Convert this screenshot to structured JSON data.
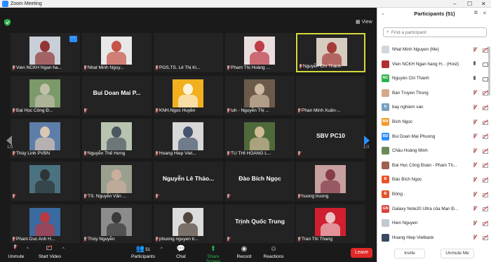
{
  "window": {
    "title": "Zoom Meeting",
    "minimize": "–",
    "maximize": "☐",
    "close": "✕"
  },
  "video": {
    "view_label": "View",
    "page_left": "1/3",
    "page_right": "1/3",
    "tiles": [
      {
        "label": "Vien NCKH Ngan ha...",
        "kind": "photo",
        "photo_color": "#c9cfd6",
        "accent": "#8a1a1a"
      },
      {
        "label": "Nhat Minh Nguy...",
        "kind": "photo",
        "photo_color": "#e8e8e8",
        "accent": "#c0392b"
      },
      {
        "label": "PGS,TS. Lê Thị Ki...",
        "kind": "empty"
      },
      {
        "label": "Pham Thị Hoàng ...",
        "kind": "photo",
        "photo_color": "#e9dede",
        "accent": "#b7202e"
      },
      {
        "label": "Nguyễn Chí Thành",
        "kind": "photo",
        "photo_color": "#d7ccc0",
        "accent": "#9b2222",
        "active": true
      },
      {
        "label": "Đại Học Công Đ...",
        "kind": "photo",
        "photo_color": "#7a9a6a",
        "accent": "#cfc5b5"
      },
      {
        "label": "",
        "kind": "name",
        "bigname": "Bui Doan Mai P..."
      },
      {
        "label": "KNH.Ngoc Huyền",
        "kind": "photo",
        "photo_color": "#f2b01e",
        "accent": "#ffffff"
      },
      {
        "label": "iuh - Nguyễn Thị ...",
        "kind": "photo",
        "photo_color": "#6b5a4a",
        "accent": "#e0c9b0"
      },
      {
        "label": "Phan Minh Xuân-...",
        "kind": "empty"
      },
      {
        "label": "Thùy Linh PVBN",
        "kind": "photo",
        "photo_color": "#5d7ea8",
        "accent": "#f1d3b7"
      },
      {
        "label": "Nguyễn Thế Hưng",
        "kind": "photo",
        "photo_color": "#b8c4b0",
        "accent": "#384552"
      },
      {
        "label": "Hoang Hiep Viet...",
        "kind": "photo",
        "photo_color": "#d8d8d8",
        "accent": "#2b3d5a"
      },
      {
        "label": "TU THI HOANG L...",
        "kind": "photo",
        "photo_color": "#4f6a3a",
        "accent": "#e8c8a8"
      },
      {
        "label": "",
        "kind": "name",
        "bigname": "SBV PC10"
      },
      {
        "label": "",
        "kind": "photo",
        "photo_color": "#4b7280",
        "accent": "#2a2a2a"
      },
      {
        "label": "TS. Nguyễn Văn ...",
        "kind": "photo",
        "photo_color": "#9aa090",
        "accent": "#d5b0a0"
      },
      {
        "label": "",
        "kind": "name",
        "bigname": "Nguyễn Lê Thảo..."
      },
      {
        "label": "",
        "kind": "name",
        "bigname": "Đào Bích Ngọc"
      },
      {
        "label": "huong truong",
        "kind": "photo",
        "photo_color": "#c8a0a0",
        "accent": "#7a2a3a"
      },
      {
        "label": "Pham Duc Anh H...",
        "kind": "photo",
        "photo_color": "#3a6aa0",
        "accent": "#d03030"
      },
      {
        "label": "Thúy Nguyễn",
        "kind": "photo",
        "photo_color": "#8c8c8c",
        "accent": "#2a2a2a"
      },
      {
        "label": "phuong nguyen tr...",
        "kind": "photo",
        "photo_color": "#dcdcdc",
        "accent": "#3a2a20"
      },
      {
        "label": "",
        "kind": "name",
        "bigname": "Trịnh Quốc Trung"
      },
      {
        "label": "Tran Thi Thang",
        "kind": "photo",
        "photo_color": "#d02030",
        "accent": "#f0e0e0"
      }
    ]
  },
  "toolbar": {
    "unmute": "Unmute",
    "start_video": "Start Video",
    "participants": "Participants",
    "participants_count": "51",
    "chat": "Chat",
    "share_screen": "Share Screen",
    "record": "Record",
    "reactions": "Reactions",
    "leave": "Leave"
  },
  "panel": {
    "title": "Participants",
    "count": "(51)",
    "search_placeholder": "Find a participant",
    "invite": "Invite",
    "unmute_me": "Unmute Me",
    "participants": [
      {
        "name": "Nhat Minh Nguyen (Me)",
        "avatar_color": "#cfd6de",
        "initials": "",
        "mic": "off",
        "cam": "off"
      },
      {
        "name": "Vien NCKH Ngan hang H... (Host)",
        "avatar_color": "#b03030",
        "initials": "",
        "mic": "on",
        "cam": "on"
      },
      {
        "name": "Nguyễn Chí Thành",
        "avatar_color": "#2bb34b",
        "initials": "NC",
        "mic": "on",
        "cam": "on"
      },
      {
        "name": "Ban Truyen Thong",
        "avatar_color": "#d3a98a",
        "initials": "",
        "mic": "off",
        "cam": "off"
      },
      {
        "name": "bay nghiem van",
        "avatar_color": "#7a9fc0",
        "initials": "b",
        "mic": "off",
        "cam": "off"
      },
      {
        "name": "Bích Ngọc",
        "avatar_color": "#f19a2a",
        "initials": "BN",
        "mic": "off",
        "cam": "off"
      },
      {
        "name": "Bui Doan Mai Phuong",
        "avatar_color": "#2d8cff",
        "initials": "BD",
        "mic": "off",
        "cam": "off"
      },
      {
        "name": "Châu Hoàng Minh",
        "avatar_color": "#6a8a5a",
        "initials": "",
        "mic": "off",
        "cam": "off"
      },
      {
        "name": "Đai Học Công Đoàn - Phạm Th...",
        "avatar_color": "#a06050",
        "initials": "",
        "mic": "off",
        "cam": "off"
      },
      {
        "name": "Đào Bích Ngọc",
        "avatar_color": "#e8522a",
        "initials": "Đ",
        "mic": "off",
        "cam": "off"
      },
      {
        "name": "Đông .",
        "avatar_color": "#e0562a",
        "initials": "Đ",
        "mic": "off",
        "cam": "off"
      },
      {
        "name": "Galaxy Note20 Ultra của Mạn Đ...",
        "avatar_color": "#d8433a",
        "initials": "GN",
        "mic": "off",
        "cam": "off"
      },
      {
        "name": "Hien Nguyen",
        "avatar_color": "#c0c8d0",
        "initials": "",
        "mic": "off",
        "cam": "off"
      },
      {
        "name": "Hoang Hiep Vietbank",
        "avatar_color": "#3a4a62",
        "initials": "",
        "mic": "off",
        "cam": "off"
      }
    ]
  }
}
